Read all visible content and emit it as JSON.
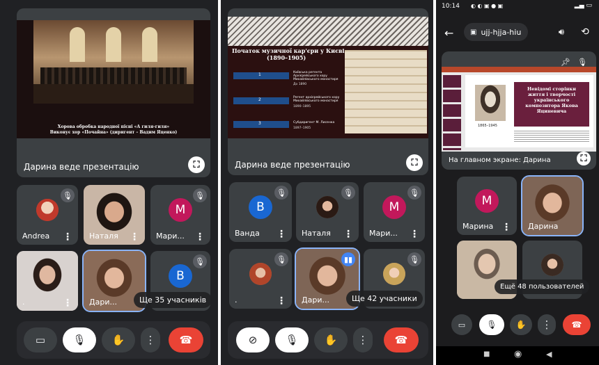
{
  "screen1": {
    "slide_caption_line1": "Хорова обробка народної пісні «А гиля-гиля»",
    "slide_caption_line2": "Виконує хор «Почайна» (диригент – Вадим Яценко)",
    "presenting_label": "Дарина веде презентацію",
    "tiles": [
      {
        "name": "Andrea",
        "type": "photo"
      },
      {
        "name": "Наталя",
        "type": "photo"
      },
      {
        "name": "Мари...",
        "type": "avatar",
        "initial": "M",
        "color": "#c2185b"
      },
      {
        "name": ".",
        "type": "photo"
      },
      {
        "name": "Дари...",
        "type": "photo"
      },
      {
        "name": "",
        "type": "avatar",
        "initial": "B",
        "color": "#1967d2"
      }
    ],
    "more_label": "Ще 35 учасників"
  },
  "screen2": {
    "slide_title_line1": "Початок музичної кар'єри у Києві",
    "slide_title_line2": "(1890–1905)",
    "timeline": [
      {
        "num": "1",
        "text": "Київська регента Архієрейського хору Михайлівського монастиря",
        "year": "До 1890"
      },
      {
        "num": "2",
        "text": "Регент архієрейського хору Михайлівського монастиря",
        "year": "1890–1895"
      },
      {
        "num": "3",
        "text": "Субдиригент М. Лисенка",
        "year": "1897–1905"
      }
    ],
    "presenting_label": "Дарина веде презентацію",
    "tiles": [
      {
        "name": "Ванда",
        "type": "avatar",
        "initial": "B",
        "color": "#1967d2"
      },
      {
        "name": "Наталя",
        "type": "photo"
      },
      {
        "name": "Мари...",
        "type": "avatar",
        "initial": "M",
        "color": "#c2185b"
      },
      {
        "name": ".",
        "type": "photo"
      },
      {
        "name": "Дари...",
        "type": "photo"
      },
      {
        "name": "",
        "type": "photo"
      }
    ],
    "more_label": "Ще 42 учасники"
  },
  "screen3": {
    "status_time": "10:14",
    "meeting_code": "ujj-hjja-hiu",
    "slide_title": "Невідомі сторінки життя і творчості українського композитора Якова Яциневича",
    "slide_years": "1865–1945",
    "main_screen_label": "На главном экране: Дарина",
    "tiles": [
      {
        "name": "Марина",
        "type": "avatar",
        "initial": "M",
        "color": "#c2185b"
      },
      {
        "name": "Дарина",
        "type": "photo"
      },
      {
        "name": "",
        "type": "photo"
      },
      {
        "name": "",
        "type": "photo"
      }
    ],
    "more_label": "Ещё 48 пользователей"
  },
  "icons": {
    "mic_off": "mic-off-icon",
    "camera": "camera-icon",
    "hand": "raise-hand-icon",
    "end_call": "end-call-icon"
  }
}
